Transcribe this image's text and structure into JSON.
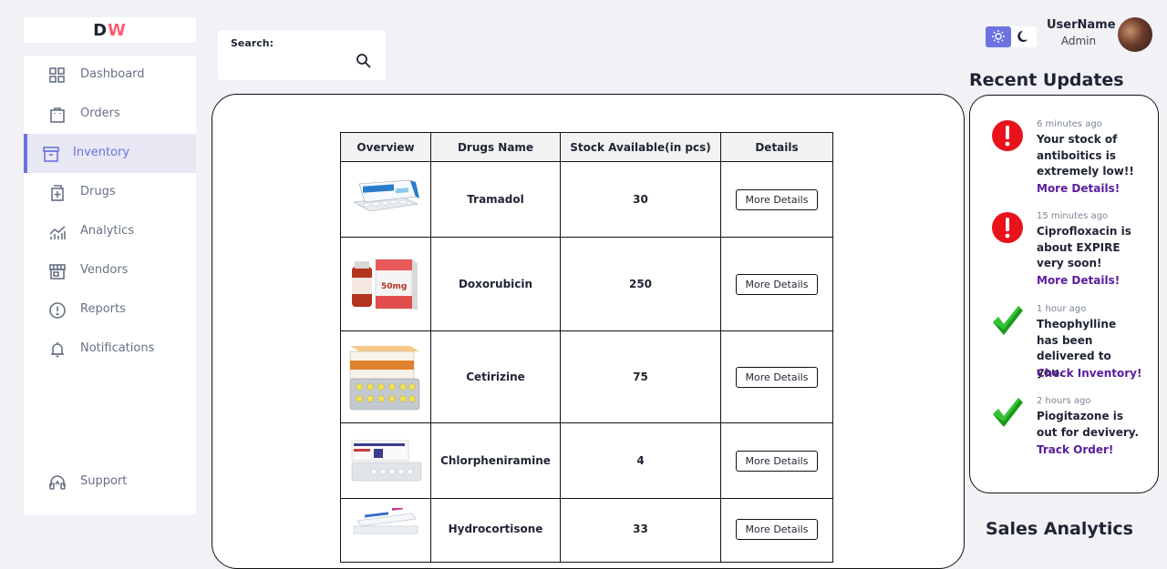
{
  "brand": {
    "first": "D",
    "second": "W"
  },
  "sidebar": {
    "items": [
      {
        "label": "Dashboard",
        "icon": "grid-icon"
      },
      {
        "label": "Orders",
        "icon": "shopping-bag-icon"
      },
      {
        "label": "Inventory",
        "icon": "archive-icon",
        "active": true
      },
      {
        "label": "Drugs",
        "icon": "medicine-icon"
      },
      {
        "label": "Analytics",
        "icon": "chart-icon"
      },
      {
        "label": "Vendors",
        "icon": "store-icon"
      },
      {
        "label": "Reports",
        "icon": "alert-circle-icon"
      },
      {
        "label": "Notifications",
        "icon": "bell-icon"
      }
    ],
    "support": "Support"
  },
  "search": {
    "label": "Search:",
    "value": ""
  },
  "table": {
    "headers": [
      "Overview",
      "Drugs Name",
      "Stock Available(in pcs)",
      "Details"
    ],
    "rows": [
      {
        "name": "Tramadol",
        "stock": "30",
        "button": "More Details"
      },
      {
        "name": "Doxorubicin",
        "stock": "250",
        "button": "More Details"
      },
      {
        "name": "Cetirizine",
        "stock": "75",
        "button": "More Details"
      },
      {
        "name": "Chlorpheniramine",
        "stock": "4",
        "button": "More Details"
      },
      {
        "name": "Hydrocortisone",
        "stock": "33",
        "button": "More Details"
      }
    ]
  },
  "user": {
    "name": "UserName",
    "role": "Admin"
  },
  "recent_updates": {
    "title": "Recent Updates",
    "items": [
      {
        "time": "6 minutes ago",
        "message": "Your stock of antiboitics is extremely low!!",
        "link": "More Details!",
        "icon": "warning-icon"
      },
      {
        "time": "15 minutes ago",
        "message": "Ciprofloxacin is about EXPIRE very soon!",
        "link": "More Details!",
        "icon": "warning-icon"
      },
      {
        "time": "1 hour ago",
        "message": "Theophylline has been delivered to you.",
        "link": "Check Inventory!",
        "icon": "checkmark-icon"
      },
      {
        "time": "2 hours ago",
        "message": "Piogitazone is out for devivery.",
        "link": "Track Order!",
        "icon": "checkmark-icon"
      }
    ]
  },
  "sales_analytics": {
    "title": "Sales Analytics"
  },
  "colors": {
    "accent": "#6c72e0",
    "brand_red": "#ff5c6e",
    "link": "#5a1c9e",
    "alert": "#e8121b",
    "success": "#1a9a1a"
  }
}
